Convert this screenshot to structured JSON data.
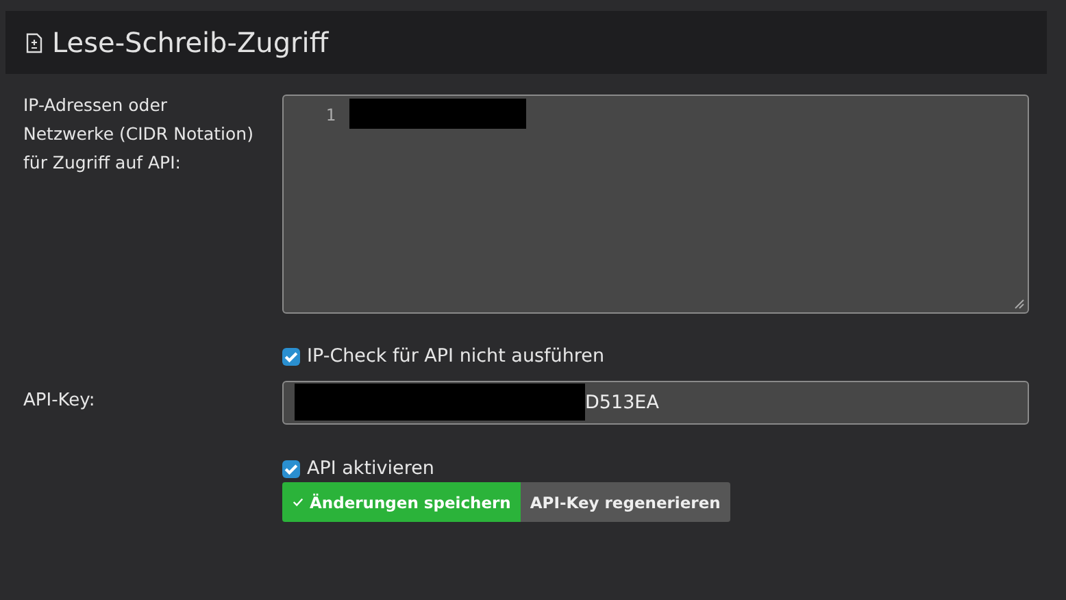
{
  "header": {
    "title": "Lese-Schreib-Zugriff"
  },
  "ip_field": {
    "label": "IP-Adressen oder Netzwerke (CIDR Notation) für Zugriff auf API:",
    "line_numbers": [
      "1"
    ],
    "redacted": true
  },
  "skip_ip_check": {
    "label": "IP-Check für API nicht ausführen",
    "checked": true
  },
  "api_key": {
    "label": "API-Key:",
    "value": "D513EA",
    "redacted": true
  },
  "api_enabled": {
    "label": "API aktivieren",
    "checked": true
  },
  "buttons": [
    {
      "kind": "save",
      "label": "Änderungen speichern"
    },
    {
      "kind": "regenerate",
      "label": "API-Key regenerieren"
    }
  ]
}
